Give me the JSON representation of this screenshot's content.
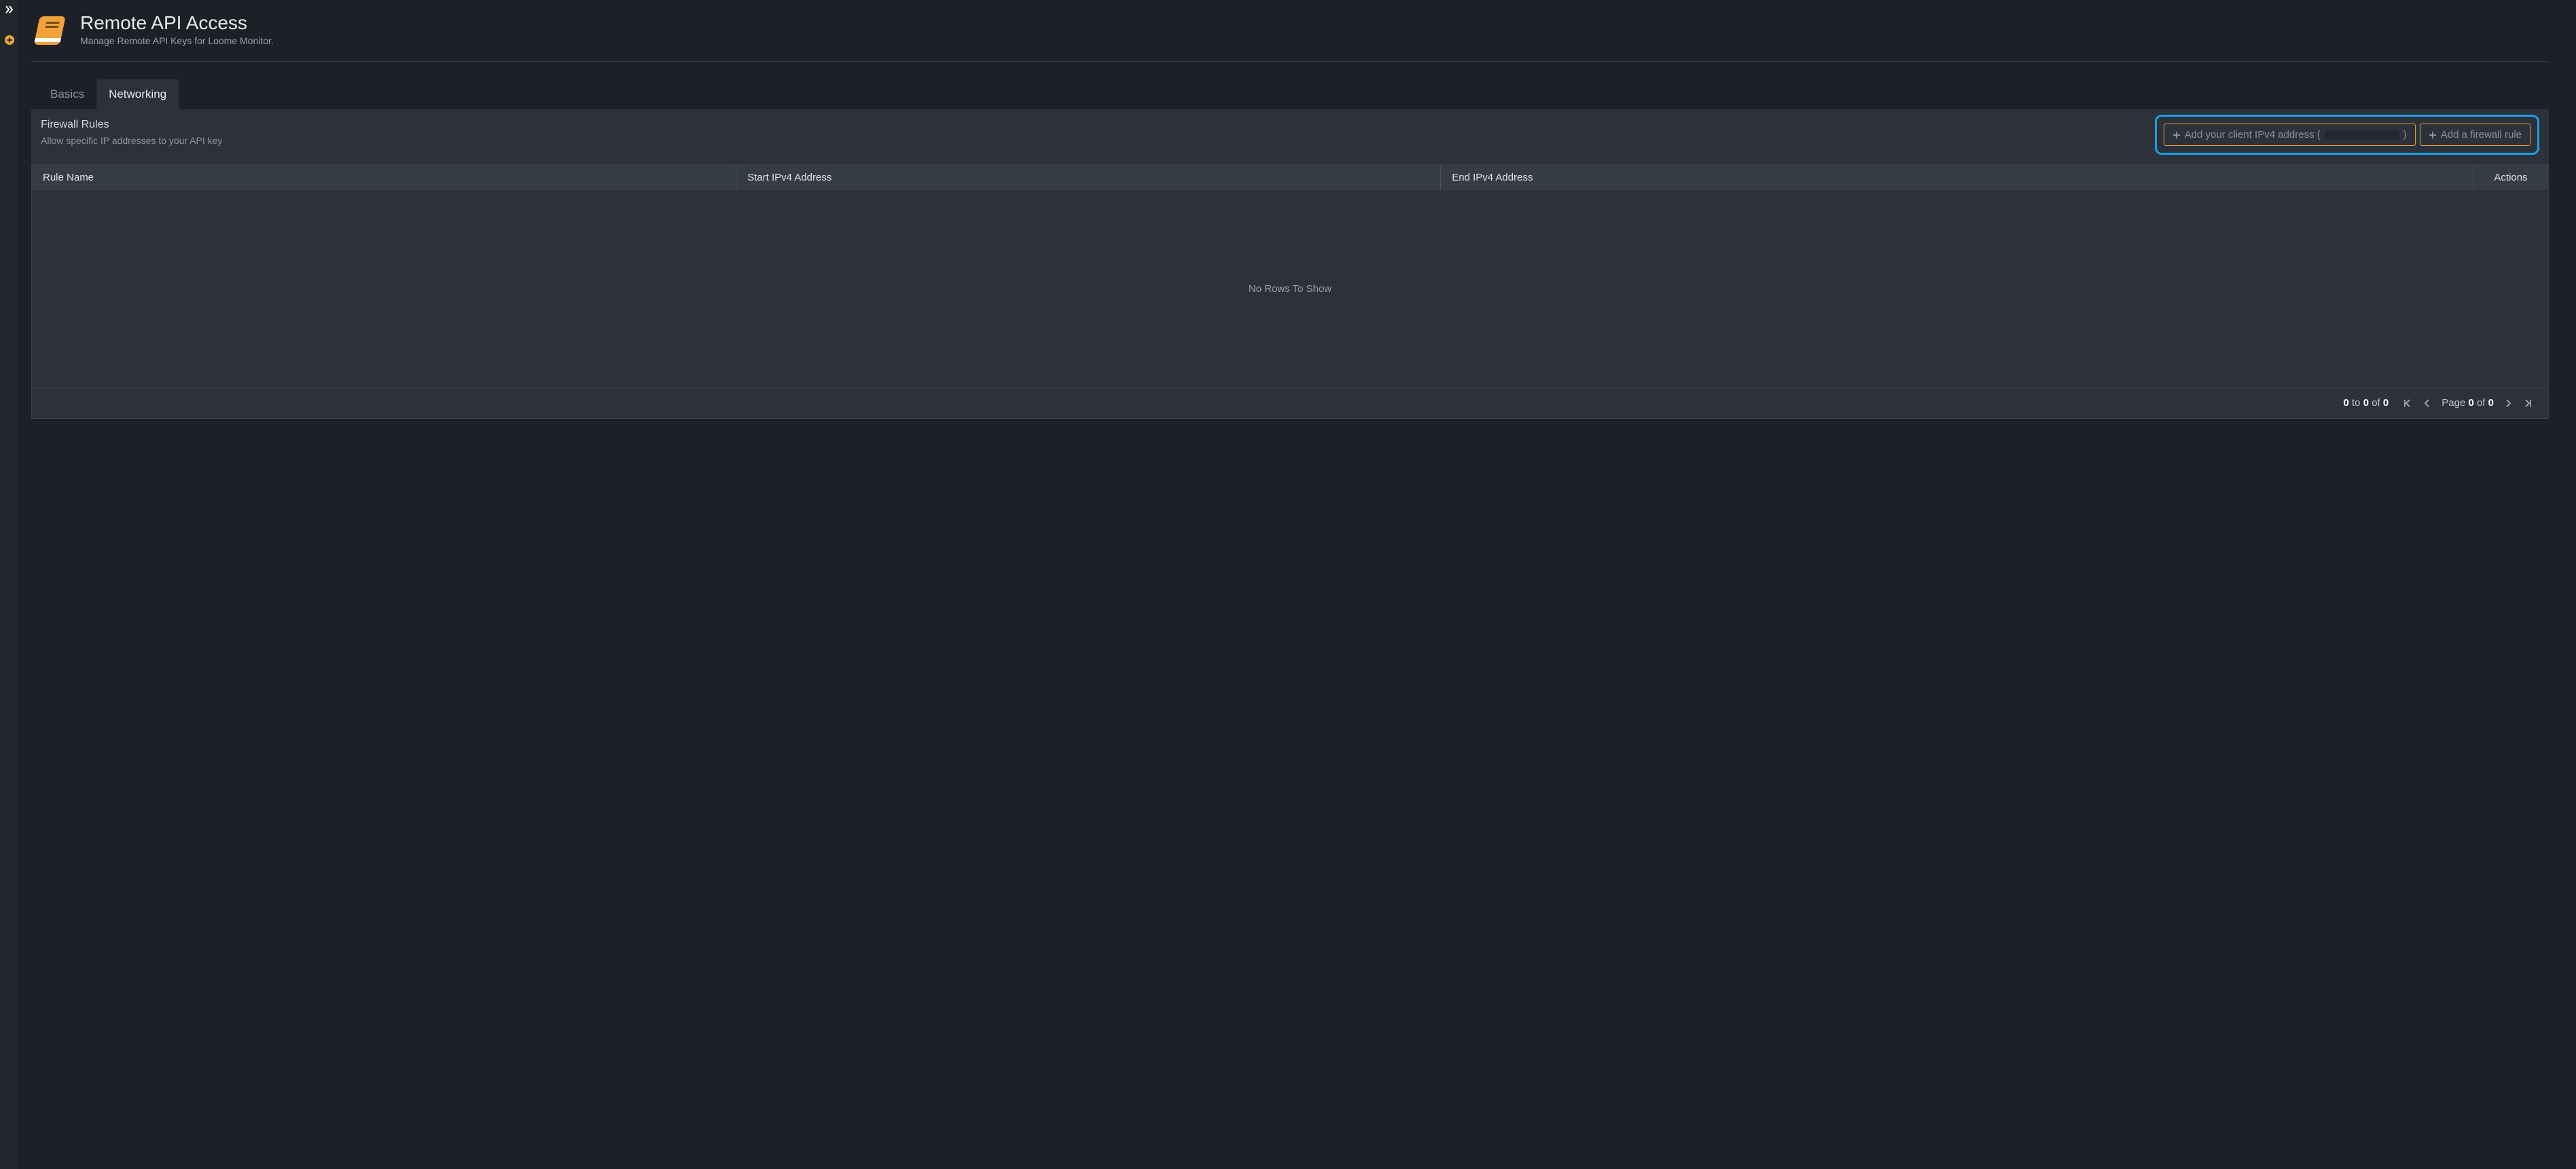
{
  "header": {
    "title": "Remote API Access",
    "subtitle": "Manage Remote API Keys for Loome Monitor."
  },
  "tabs": {
    "basics": "Basics",
    "networking": "Networking"
  },
  "panel": {
    "title": "Firewall Rules",
    "description": "Allow specific IP addresses to your API key",
    "add_client_ip_prefix": "Add your client IPv4 address (",
    "add_client_ip_suffix": ")",
    "add_rule": "Add a firewall rule"
  },
  "columns": {
    "name": "Rule Name",
    "start": "Start IPv4 Address",
    "end": "End IPv4 Address",
    "actions": "Actions"
  },
  "grid": {
    "empty": "No Rows To Show",
    "range_from": "0",
    "range_sep1": " to ",
    "range_to": "0",
    "range_sep2": " of ",
    "range_total": "0",
    "page_prefix": "Page ",
    "page_current": "0",
    "page_sep": " of ",
    "page_total": "0"
  }
}
